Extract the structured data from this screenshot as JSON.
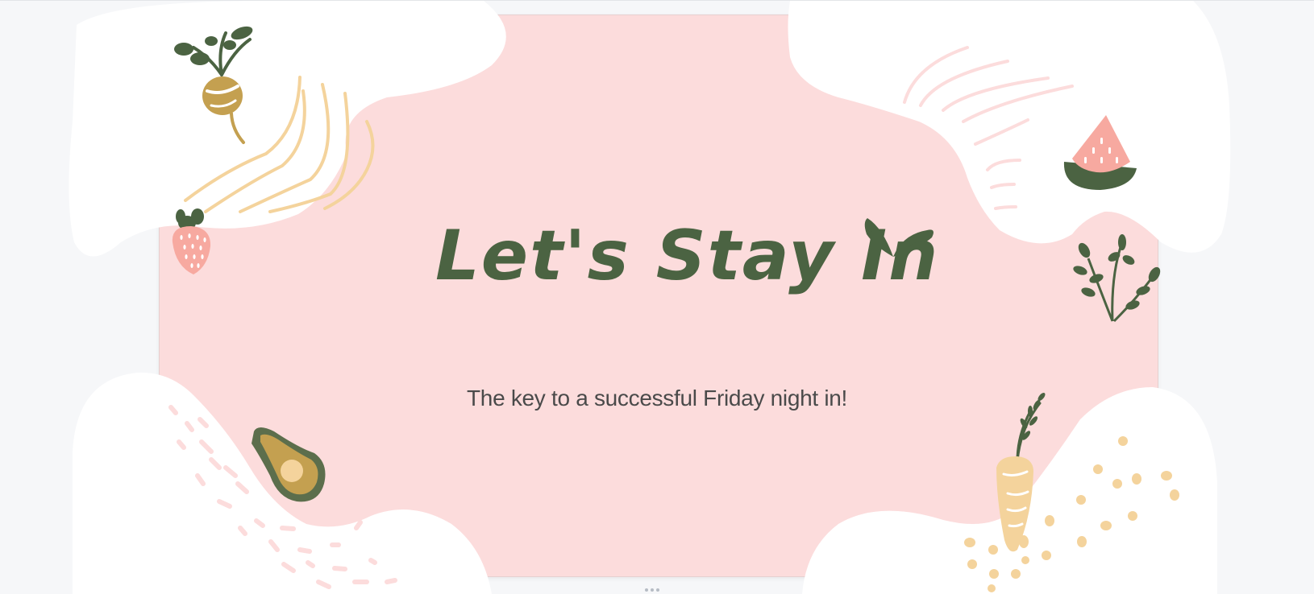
{
  "slide": {
    "title": "Let's Stay In",
    "subtitle": "The key to a successful Friday night in!"
  },
  "colors": {
    "background": "#f6f7f9",
    "slide_fill": "#fcdcdc",
    "blob_white": "#ffffff",
    "title_green": "#4b6342",
    "subtitle_gray": "#4a4a4a",
    "mustard": "#c4a050",
    "peach": "#f4d39c",
    "pink_accent": "#f7a9a0"
  },
  "icons": {
    "turnip": "turnip-icon",
    "strawberry": "strawberry-icon",
    "watermelon": "watermelon-icon",
    "herb": "herb-sprig-icon",
    "avocado": "avocado-icon",
    "carrot": "carrot-icon",
    "leaf": "leaf-icon",
    "resize": "resize-handle-icon"
  }
}
